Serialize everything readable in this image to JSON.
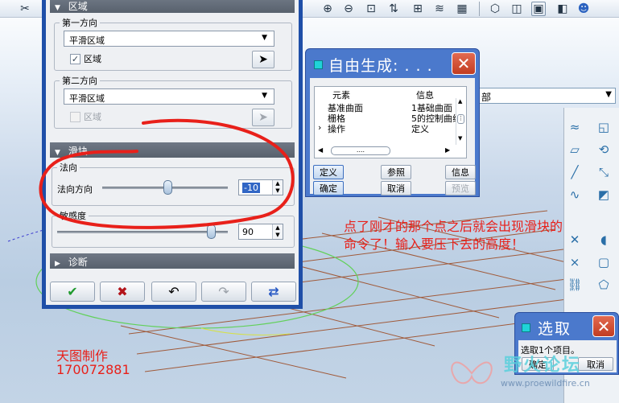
{
  "main_dialog": {
    "area_section": {
      "title": "区域",
      "first_direction": {
        "label": "第一方向",
        "combo_value": "平滑区域",
        "checkbox_label": "区域",
        "checked": true
      },
      "second_direction": {
        "label": "第二方向",
        "combo_value": "平滑区域",
        "checkbox_label": "区域",
        "checked": false
      }
    },
    "slider_section": {
      "title": "滑块",
      "normal_group": {
        "label": "法向",
        "slider_label": "法向方向",
        "value": "-10",
        "slider_fraction": 0.52
      },
      "sensitivity_group": {
        "label": "敏感度",
        "value": "90",
        "slider_fraction": 0.9
      }
    },
    "diagnose_section": {
      "title": "诊断"
    },
    "buttons": {
      "ok_icon": "check-icon",
      "cancel_icon": "x-icon",
      "undo_icon": "undo-icon",
      "redo_icon": "redo-icon",
      "refresh_icon": "refresh-icon"
    }
  },
  "gen_dialog": {
    "title": "自由生成: . . .",
    "columns": [
      "元素",
      "信息"
    ],
    "rows": [
      {
        "element": "基准曲面",
        "info": "1基础曲面"
      },
      {
        "element": "栅格",
        "info": "5的控制曲线"
      },
      {
        "element": "操作",
        "info": "定义"
      }
    ],
    "scroll_thumb": "....",
    "buttons": {
      "define": "定义",
      "reference": "参照",
      "info": "信息",
      "ok": "确定",
      "cancel": "取消",
      "preview": "预览"
    }
  },
  "select_dialog": {
    "title": "选取",
    "message": "选取1个项目。",
    "ok": "确定",
    "cancel": "取消"
  },
  "filter": {
    "value": "部"
  },
  "annotations": {
    "note_line1": "点了刚才的那个点之后就会出现滑块的",
    "note_line2": "命令了！输入要压下去的高度！",
    "credit_line1": "天图制作",
    "credit_line2": "170072881"
  },
  "watermark": {
    "brand": "野火论坛",
    "url": "www.proewildfire.cn"
  },
  "colors": {
    "dialog_frame": "#1f4fa8",
    "section_header": "#5d6672",
    "annotation_red": "#e8201a",
    "grid_line": "#a05a3a"
  }
}
